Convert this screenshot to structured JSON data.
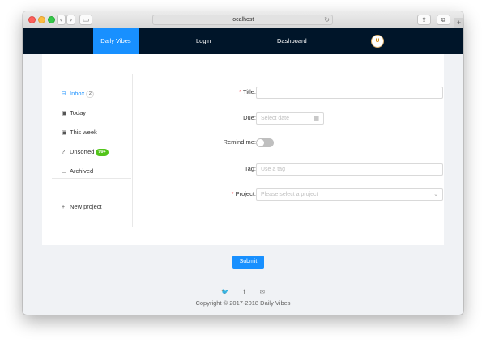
{
  "browser": {
    "url": "localhost",
    "back_glyph": "‹",
    "forward_glyph": "›",
    "sidebar_glyph": "▭",
    "reload_glyph": "↻",
    "share_glyph": "⇪",
    "tabs_glyph": "⧉",
    "new_tab_glyph": "+"
  },
  "header": {
    "brand": "Daily Vibes",
    "login": "Login",
    "dashboard": "Dashboard",
    "avatar_initial": "U",
    "brand_color": "#1890ff",
    "bg_color": "#001529"
  },
  "sidebar": {
    "items": [
      {
        "label": "Inbox",
        "icon": "inbox-icon",
        "glyph": "⊟",
        "badge": "2"
      },
      {
        "label": "Today",
        "icon": "calendar-icon",
        "glyph": "▣"
      },
      {
        "label": "This week",
        "icon": "calendar-week-icon",
        "glyph": "▣"
      },
      {
        "label": "Unsorted",
        "icon": "question-icon",
        "glyph": "?",
        "badge": "99+"
      },
      {
        "label": "Archived",
        "icon": "laptop-icon",
        "glyph": "▭"
      }
    ],
    "new_project": {
      "label": "New project",
      "icon": "plus-icon",
      "glyph": "+"
    }
  },
  "form": {
    "title": {
      "label": "Title",
      "required": "*",
      "colon": ":",
      "value": ""
    },
    "due": {
      "label": "Due",
      "colon": ":",
      "placeholder": "Select date",
      "glyph": "▦"
    },
    "remind": {
      "label": "Remind me",
      "colon": ":",
      "on": false
    },
    "tag": {
      "label": "Tag",
      "colon": ":",
      "placeholder": "Use a tag"
    },
    "project": {
      "label": "Project",
      "required": "*",
      "colon": ":",
      "placeholder": "Please select a project",
      "glyph": "⌄"
    },
    "submit": "Submit"
  },
  "footer": {
    "icons": [
      {
        "name": "twitter-icon",
        "glyph": "🐦"
      },
      {
        "name": "facebook-icon",
        "glyph": "f"
      },
      {
        "name": "mail-icon",
        "glyph": "✉"
      }
    ],
    "copyright": "Copyright © 2017-2018 Daily Vibes"
  }
}
